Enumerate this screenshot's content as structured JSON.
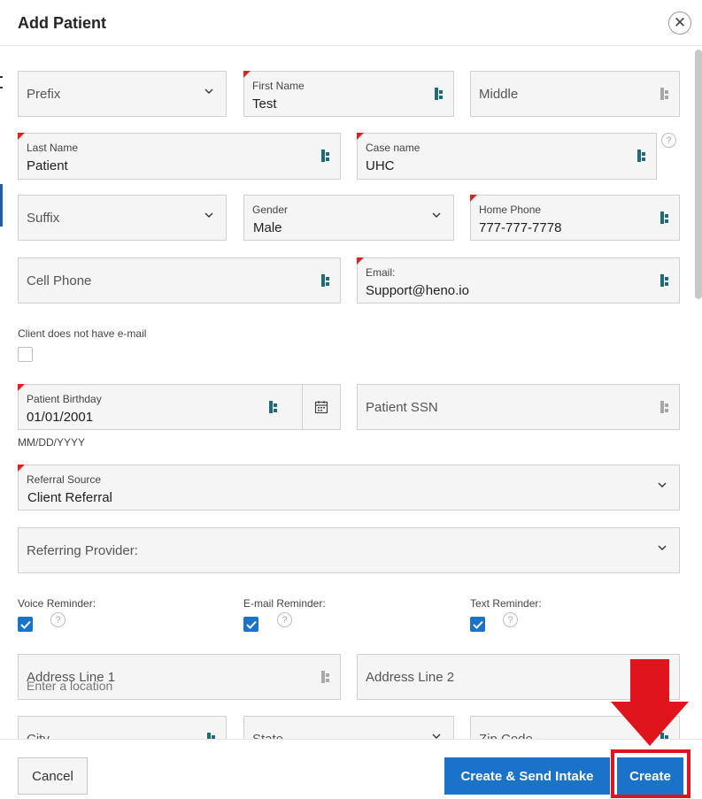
{
  "dialog": {
    "title": "Add Patient"
  },
  "fields": {
    "prefix": {
      "placeholder": "Prefix"
    },
    "first_name": {
      "label": "First Name",
      "value": "Test"
    },
    "middle": {
      "placeholder": "Middle"
    },
    "last_name": {
      "label": "Last Name",
      "value": "Patient"
    },
    "case_name": {
      "label": "Case name",
      "value": "UHC"
    },
    "suffix": {
      "placeholder": "Suffix"
    },
    "gender": {
      "label": "Gender",
      "value": "Male"
    },
    "home_phone": {
      "label": "Home Phone",
      "value": "777-777-7778"
    },
    "cell_phone": {
      "placeholder": "Cell Phone"
    },
    "email": {
      "label": "Email:",
      "value": "Support@heno.io"
    },
    "no_email": {
      "label": "Client does not have e-mail",
      "checked": false
    },
    "birthday": {
      "label": "Patient Birthday",
      "value": "01/01/2001",
      "hint": "MM/DD/YYYY"
    },
    "ssn": {
      "placeholder": "Patient SSN"
    },
    "referral_source": {
      "label": "Referral Source",
      "value": "Client Referral"
    },
    "referring_provider": {
      "placeholder": "Referring Provider:"
    },
    "voice_reminder": {
      "label": "Voice Reminder:",
      "checked": true
    },
    "email_reminder": {
      "label": "E-mail Reminder:",
      "checked": true
    },
    "text_reminder": {
      "label": "Text Reminder:",
      "checked": true
    },
    "address1": {
      "placeholder": "Address Line 1",
      "overlay": "Enter a location"
    },
    "address2": {
      "placeholder": "Address Line 2"
    },
    "city": {
      "placeholder": "City"
    },
    "state": {
      "placeholder": "State"
    },
    "zip": {
      "placeholder": "Zip Code"
    }
  },
  "footer": {
    "cancel_label": "Cancel",
    "send_label": "Create & Send Intake",
    "create_label": "Create"
  },
  "colors": {
    "primary": "#1a73c9",
    "required_marker": "#e0211f",
    "annotation": "#e0141c"
  }
}
